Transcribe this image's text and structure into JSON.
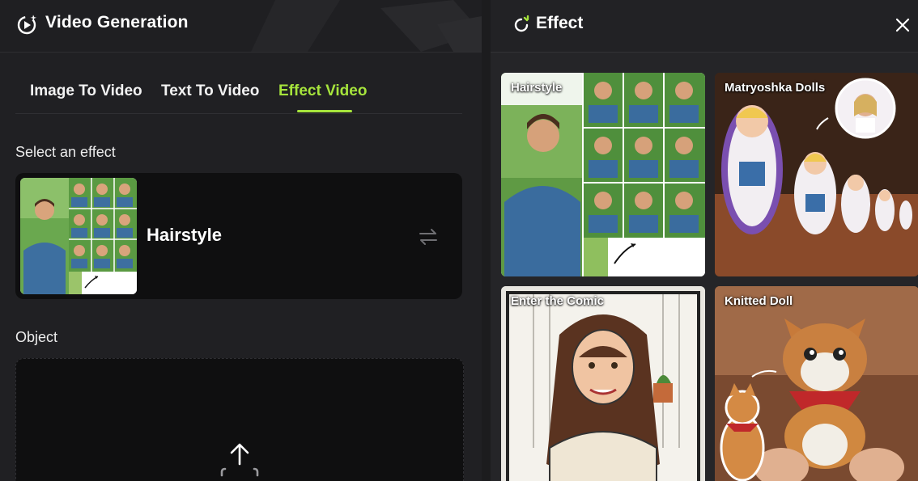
{
  "left_panel": {
    "header": {
      "title": "Video Generation",
      "icon": "video-generation-icon"
    },
    "tabs": [
      {
        "label": "Image To Video",
        "active": false
      },
      {
        "label": "Text To Video",
        "active": false
      },
      {
        "label": "Effect Video",
        "active": true
      }
    ],
    "select_effect": {
      "label": "Select an effect",
      "selected_effect": "Hairstyle",
      "swap_icon": "swap-arrows-icon"
    },
    "object": {
      "label": "Object",
      "upload_icon": "upload-arrow-icon"
    }
  },
  "right_panel": {
    "header": {
      "title": "Effect",
      "icon": "effect-refresh-icon",
      "close_icon": "close-icon"
    },
    "effects": [
      {
        "label": "Hairstyle"
      },
      {
        "label": "Matryoshka Dolls"
      },
      {
        "label": "Enter the Comic"
      },
      {
        "label": "Knitted Doll"
      }
    ]
  },
  "colors": {
    "accent": "#a6e43c",
    "background": "#1c1c1e",
    "panel": "#202023",
    "card": "#0f0f10"
  }
}
